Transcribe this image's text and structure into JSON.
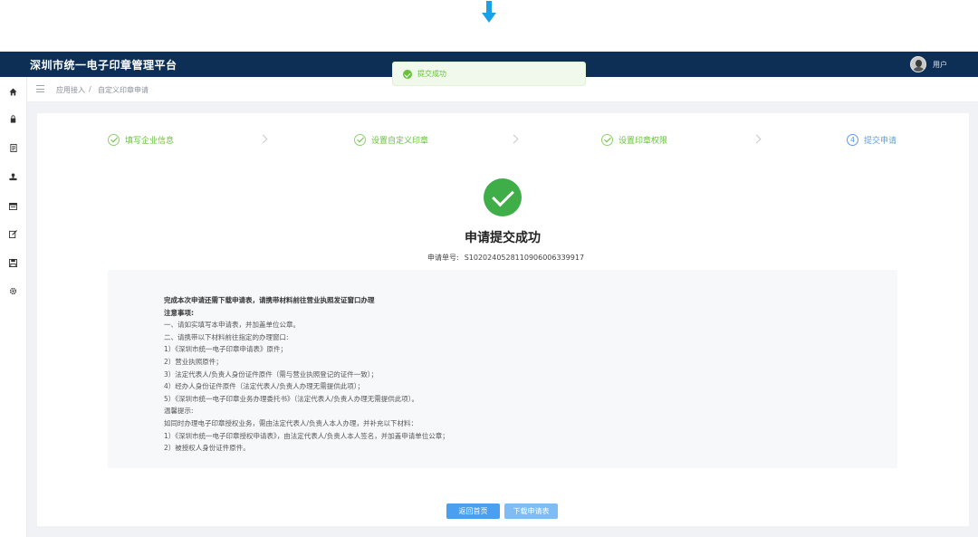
{
  "header": {
    "app_title": "深圳市统一电子印章管理平台",
    "user_name": "用户"
  },
  "toast": {
    "message": "提交成功",
    "status_color": "#67c23a"
  },
  "sidebar": {
    "icons": [
      "home-icon",
      "lock-icon",
      "document-icon",
      "seal-icon",
      "list-icon",
      "edit-icon",
      "save-icon",
      "gear-icon"
    ]
  },
  "breadcrumb": {
    "items": [
      "应用接入",
      "自定义印章申请"
    ],
    "separator": "/"
  },
  "steps": [
    {
      "label": "填写企业信息",
      "state": "done"
    },
    {
      "label": "设置自定义印章",
      "state": "done"
    },
    {
      "label": "设置印章权限",
      "state": "done"
    },
    {
      "label": "提交申请",
      "state": "active",
      "number": "4"
    }
  ],
  "result": {
    "title": "申请提交成功",
    "apply_no_label": "申请单号:",
    "apply_no_value": "S10202405281109060063399​17"
  },
  "notice": {
    "lines": [
      {
        "text": "完成本次申请还需下载申请表，请携带材料前往营业执照发证窗口办理",
        "bold": true
      },
      {
        "text": "注意事项:",
        "bold": true
      },
      {
        "text": "一、请如实填写本申请表，并加盖单位公章。",
        "bold": false
      },
      {
        "text": "二、请携带以下材料前往指定的办理窗口:",
        "bold": false
      },
      {
        "text": "1）《深圳市统一电子印章申请表》原件；",
        "bold": false
      },
      {
        "text": "2）营业执照原件；",
        "bold": false
      },
      {
        "text": "3）法定代表人/负责人身份证件原件（需与营业执照登记的证件一致）；",
        "bold": false
      },
      {
        "text": "4）经办人身份证件原件（法定代表人/负责人办理无需提供此项）；",
        "bold": false
      },
      {
        "text": "5）《深圳市统一电子印章业务办理委托书》（法定代表人/负责人办理无需提供此项）。",
        "bold": false
      },
      {
        "text": "温馨提示:",
        "bold": false
      },
      {
        "text": "如同时办理电子印章授权业务，需由法定代表人/负责人本人办理，并补充以下材料：",
        "bold": false
      },
      {
        "text": "1）《深圳市统一电子印章授权申请表》，由法定代表人/负责人本人签名，并加盖申请单位公章；",
        "bold": false
      },
      {
        "text": "2）被授权人身份证件原件。",
        "bold": false
      }
    ]
  },
  "buttons": {
    "back": "返回首页",
    "download": "下载申请表"
  },
  "colors": {
    "header_bg": "#0d2f55",
    "success": "#3fae49",
    "step_done": "#67c23a",
    "step_active": "#5b9ce6",
    "primary_button": "#4a9ff0"
  }
}
